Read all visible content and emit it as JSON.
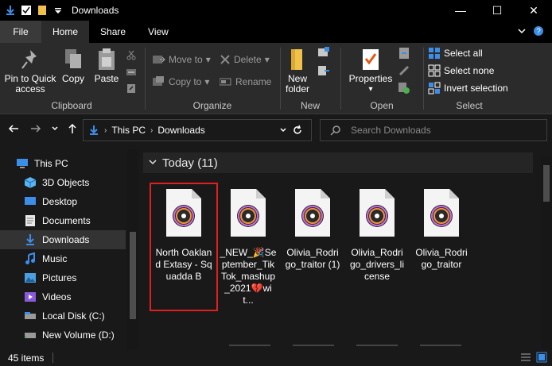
{
  "window": {
    "title": "Downloads",
    "controls": {
      "minimize": "—",
      "maximize": "☐",
      "close": "✕"
    }
  },
  "ribbon_tabs": [
    "File",
    "Home",
    "Share",
    "View"
  ],
  "ribbon": {
    "clipboard": {
      "pin_label_1": "Pin to Quick",
      "pin_label_2": "access",
      "copy": "Copy",
      "paste": "Paste",
      "group": "Clipboard"
    },
    "organize": {
      "move_to": "Move to",
      "copy_to": "Copy to",
      "delete": "Delete",
      "rename": "Rename",
      "group": "Organize"
    },
    "new": {
      "new_folder_1": "New",
      "new_folder_2": "folder",
      "group": "New"
    },
    "open": {
      "properties": "Properties",
      "group": "Open"
    },
    "select": {
      "select_all": "Select all",
      "select_none": "Select none",
      "invert": "Invert selection",
      "group": "Select"
    }
  },
  "address": {
    "crumbs": [
      "This PC",
      "Downloads"
    ],
    "search_placeholder": "Search Downloads"
  },
  "nav": {
    "items": [
      {
        "label": "This PC",
        "icon": "computer-icon"
      },
      {
        "label": "3D Objects",
        "icon": "cube-icon"
      },
      {
        "label": "Desktop",
        "icon": "desktop-icon"
      },
      {
        "label": "Documents",
        "icon": "document-icon"
      },
      {
        "label": "Downloads",
        "icon": "download-icon",
        "selected": true
      },
      {
        "label": "Music",
        "icon": "music-icon"
      },
      {
        "label": "Pictures",
        "icon": "pictures-icon"
      },
      {
        "label": "Videos",
        "icon": "video-icon"
      },
      {
        "label": "Local Disk (C:)",
        "icon": "drive-icon"
      },
      {
        "label": "New Volume (D:)",
        "icon": "drive-icon"
      }
    ]
  },
  "content": {
    "group_title": "Today (11)",
    "files": [
      {
        "name": "North Oakland Extasy - Squadda B",
        "icon": "audio-file-icon"
      },
      {
        "name": "_NEW_🎉September_TikTok_mashup_2021💔wit...",
        "icon": "audio-file-icon"
      },
      {
        "name": "Olivia_Rodrigo_traitor (1)",
        "icon": "audio-file-icon"
      },
      {
        "name": "Olivia_Rodrigo_drivers_license",
        "icon": "audio-file-icon"
      },
      {
        "name": "Olivia_Rodrigo_traitor",
        "icon": "audio-file-icon"
      }
    ]
  },
  "status": {
    "items_count": "45 items"
  },
  "colors": {
    "background": "#191919",
    "ribbon": "#2b2b2b",
    "titlebar": "#000000",
    "accent_blue": "#3c8ee8",
    "highlight_red": "#e02020",
    "folder_yellow": "#f0c24a"
  }
}
